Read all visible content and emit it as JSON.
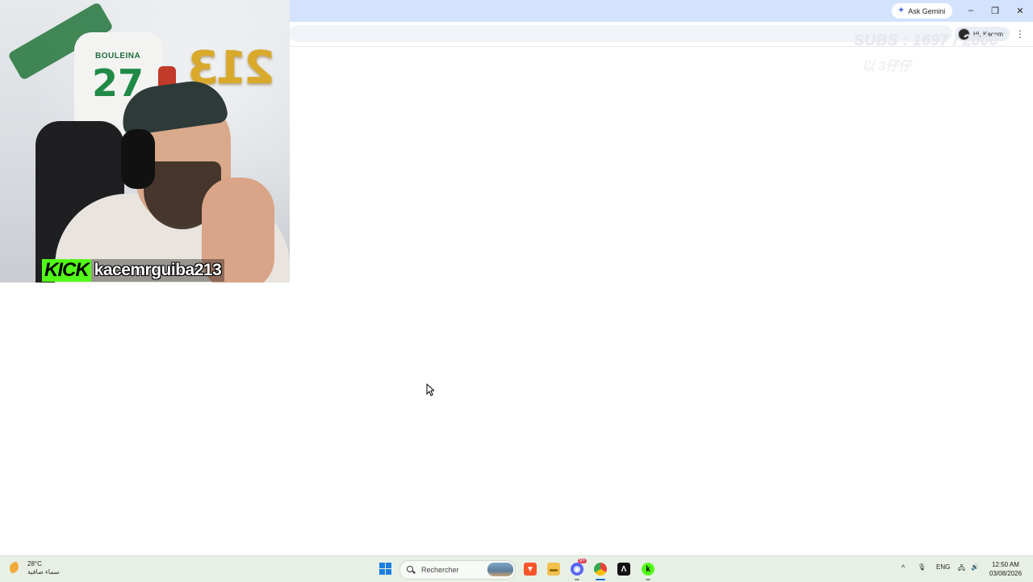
{
  "browser": {
    "ask_gemini_label": "Ask Gemini",
    "minimize": "–",
    "restore": "❐",
    "close": "✕",
    "profile_label": "Hi, Kacem",
    "menu_icon": "⋮"
  },
  "stream_overlay": {
    "subs_line1": "SUBS : 1697 / 2000",
    "subs_line2": "以 3仔仔",
    "kick_logo": "KICK",
    "channel_name": "kacemrguiba213"
  },
  "webcam_scene": {
    "jersey_name": "BOULEINA",
    "jersey_number": "27",
    "balloons": "213"
  },
  "taskbar": {
    "weather_temp": "28°C",
    "weather_condition": "سماء صافية",
    "search_placeholder": "Rechercher",
    "language": "ENG",
    "time": "12:50 AM",
    "date": "03/08/2026",
    "discord_badge": "9+",
    "chevron_icon": "^",
    "mic_icon": "🎙",
    "network_icon": "🖧",
    "volume_icon": "🔊"
  }
}
